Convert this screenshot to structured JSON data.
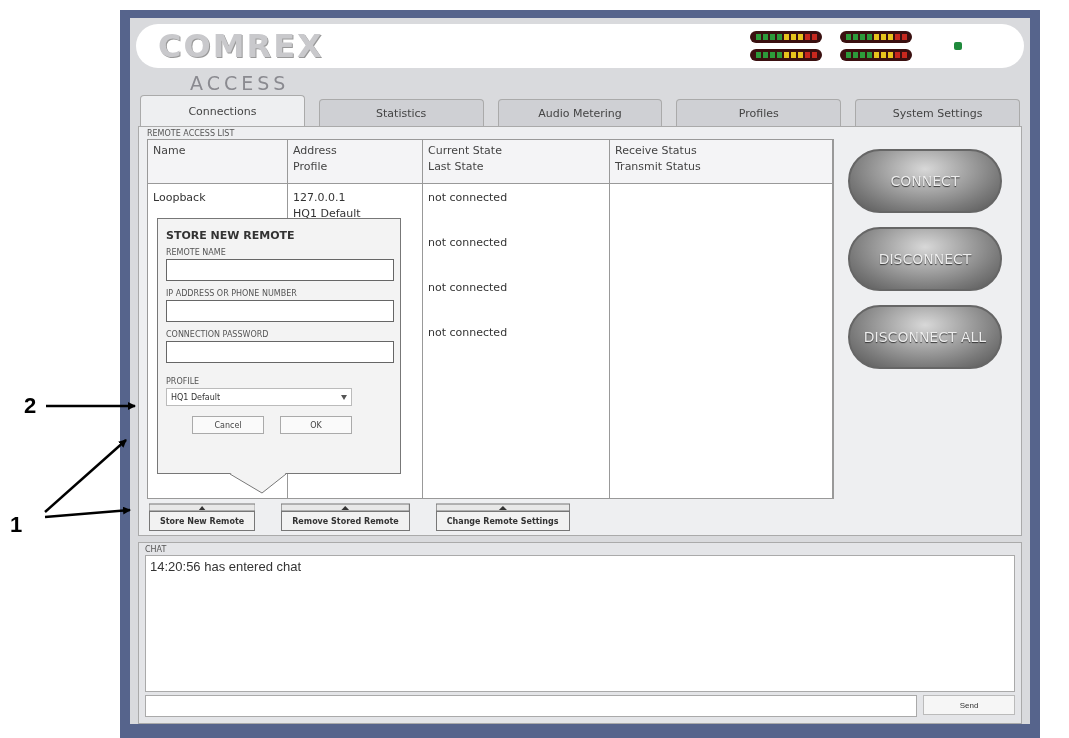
{
  "annotations": [
    {
      "label": "2"
    },
    {
      "label": "1"
    }
  ],
  "header": {
    "logo": "COMREX",
    "product": "ACCESS"
  },
  "tabs": [
    {
      "label": "Connections",
      "selected": true
    },
    {
      "label": "Statistics",
      "selected": false
    },
    {
      "label": "Audio Metering",
      "selected": false
    },
    {
      "label": "Profiles",
      "selected": false
    },
    {
      "label": "System Settings",
      "selected": false
    }
  ],
  "remote_list": {
    "label": "REMOTE ACCESS LIST",
    "columns": [
      {
        "line1": "Name"
      },
      {
        "line1": "Address",
        "line2": "Profile"
      },
      {
        "line1": "Current State",
        "line2": "Last State"
      },
      {
        "line1": "Receive Status",
        "line2": "Transmit Status"
      }
    ],
    "rows": [
      {
        "name": "Loopback",
        "address": "127.0.0.1",
        "profile": "HQ1 Default",
        "state": "not connected"
      },
      {
        "state": "not connected"
      },
      {
        "state": "not connected"
      },
      {
        "state": "not connected"
      }
    ]
  },
  "dialog": {
    "title": "STORE NEW REMOTE",
    "fields": [
      {
        "kind": "text",
        "label": "REMOTE NAME"
      },
      {
        "kind": "text",
        "label": "IP ADDRESS OR PHONE NUMBER"
      },
      {
        "kind": "text",
        "label": "CONNECTION PASSWORD"
      },
      {
        "kind": "select",
        "label": "PROFILE",
        "value": "HQ1 Default"
      }
    ],
    "buttons": [
      "Cancel",
      "OK"
    ]
  },
  "remote_buttons": [
    "Store New Remote",
    "Remove Stored Remote",
    "Change Remote Settings"
  ],
  "side_buttons": [
    "CONNECT",
    "DISCONNECT",
    "DISCONNECT ALL"
  ],
  "chat": {
    "label": "CHAT",
    "messages": [
      "14:20:56 has entered chat"
    ],
    "send": "Send"
  }
}
